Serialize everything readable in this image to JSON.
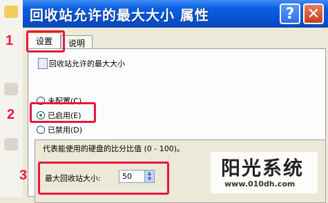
{
  "window": {
    "title": "回收站允许的最大大小 属性",
    "help_glyph": "?",
    "close_glyph": "✕"
  },
  "tabs": [
    {
      "label": "设置",
      "active": true
    },
    {
      "label": "说明",
      "active": false
    }
  ],
  "policy": {
    "title": "回收站允许的最大大小",
    "options": [
      {
        "label": "未配置(C)",
        "checked": false
      },
      {
        "label": "已启用(E)",
        "checked": true
      },
      {
        "label": "已禁用(D)",
        "checked": false
      }
    ],
    "description": "代表能使用的硬盘的比分比值 (0 - 100)。",
    "size_label": "最大回收站大小:",
    "size_value": "50"
  },
  "annotations": {
    "n1": "1",
    "n2": "2",
    "n3": "3"
  },
  "watermark": {
    "brand": "阳光系统",
    "url": "www.010dh.com"
  },
  "colors": {
    "titlebar": "#0551d2",
    "highlight": "#e8173c",
    "radio_checked": "#21a121"
  }
}
